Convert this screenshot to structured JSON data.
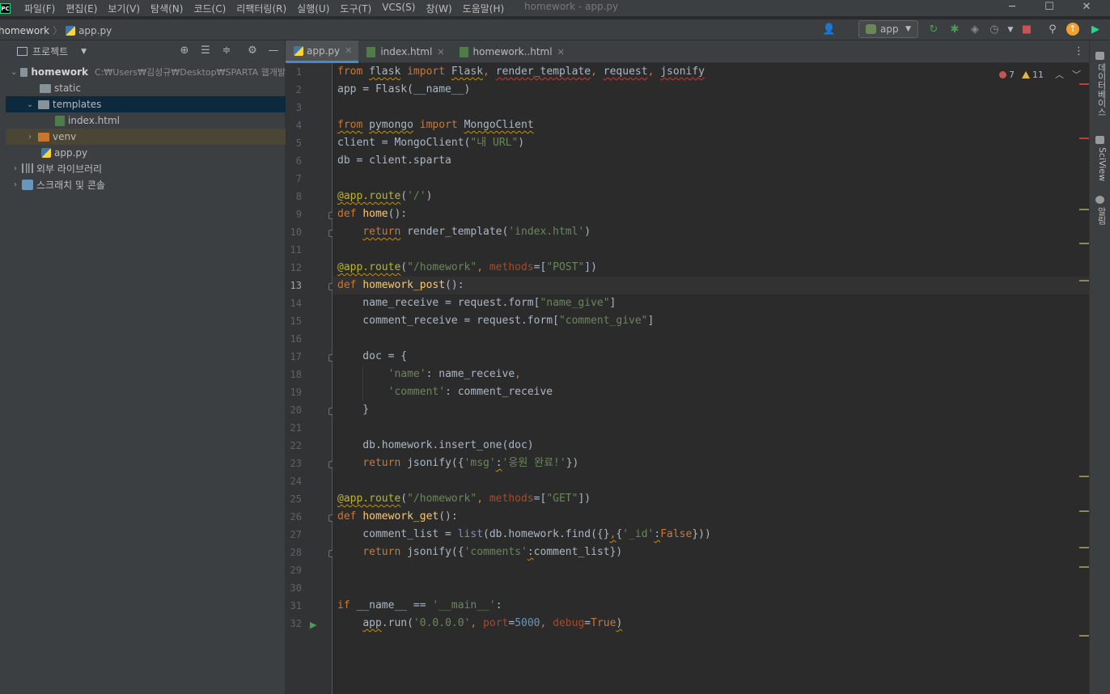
{
  "app_logo": "PC",
  "window": {
    "title": "homework - app.py",
    "menu": [
      "파일(F)",
      "편집(E)",
      "보기(V)",
      "탐색(N)",
      "코드(C)",
      "리팩터링(R)",
      "실행(U)",
      "도구(T)",
      "VCS(S)",
      "창(W)",
      "도움말(H)"
    ],
    "controls": {
      "minimize": "─",
      "maximize": "☐",
      "close": "✕"
    }
  },
  "navbar": {
    "project": "homework",
    "file": "app.py",
    "run_config": "app"
  },
  "project_panel": {
    "title": "프로젝트",
    "tree": [
      {
        "label": "homework",
        "path": "C:₩Users₩김성규₩Desktop₩SPARTA 웹개발",
        "level": 0,
        "arrow": "v",
        "icon": "folder"
      },
      {
        "label": "static",
        "level": 1,
        "arrow": "",
        "icon": "folder"
      },
      {
        "label": "templates",
        "level": 1,
        "arrow": "v",
        "icon": "folder"
      },
      {
        "label": "index.html",
        "level": 2,
        "arrow": "",
        "icon": "html"
      },
      {
        "label": "venv",
        "level": 1,
        "arrow": ">",
        "icon": "folder-orange"
      },
      {
        "label": "app.py",
        "level": 1,
        "arrow": "",
        "icon": "python"
      },
      {
        "label": "외부 라이브러리",
        "level": 0,
        "arrow": ">",
        "icon": "library"
      },
      {
        "label": "스크래치 및 콘솔",
        "level": 0,
        "arrow": ">",
        "icon": "scratch"
      }
    ]
  },
  "tabs": [
    {
      "label": "app.py",
      "active": true,
      "icon": "python"
    },
    {
      "label": "index.html",
      "active": false,
      "icon": "html"
    },
    {
      "label": "homework..html",
      "active": false,
      "icon": "html"
    }
  ],
  "inspections": {
    "errors": "7",
    "warnings": "11"
  },
  "line_numbers": [
    "1",
    "2",
    "3",
    "4",
    "5",
    "6",
    "7",
    "8",
    "9",
    "10",
    "11",
    "12",
    "13",
    "14",
    "15",
    "16",
    "17",
    "18",
    "19",
    "20",
    "21",
    "22",
    "23",
    "24",
    "25",
    "26",
    "27",
    "28",
    "29",
    "30",
    "31",
    "32"
  ],
  "current_line": 13,
  "code": {
    "l1": [
      "from",
      " ",
      "flask",
      " ",
      "import",
      " ",
      "Flask",
      ", ",
      "render_template",
      ", ",
      "request",
      ", ",
      "jsonify"
    ],
    "l2": "app = Flask(__name__)",
    "l4": [
      "from",
      " ",
      "pymongo",
      " ",
      "import",
      " ",
      "MongoClient"
    ],
    "l5": [
      "client = MongoClient(",
      "\"내 URL\"",
      ")"
    ],
    "l6": "db = client.sparta",
    "l8": [
      "@app.route",
      "(",
      "'/'",
      ")"
    ],
    "l9": [
      "def",
      " ",
      "home",
      "():"
    ],
    "l10": [
      "    ",
      "return",
      " render_template(",
      "'index.html'",
      ")"
    ],
    "l12": [
      "@app.route",
      "(",
      "\"/homework\"",
      ", ",
      "methods",
      "=[",
      "\"POST\"",
      "])"
    ],
    "l13": [
      "def",
      " ",
      "homework_post",
      "():"
    ],
    "l14": [
      "    name_receive = request.form[",
      "\"name_give\"",
      "]"
    ],
    "l15": [
      "    comment_receive = request.form[",
      "\"comment_give\"",
      "]"
    ],
    "l17": "    doc = {",
    "l18": [
      "        ",
      "'name'",
      ": name_receive",
      ","
    ],
    "l19": [
      "        ",
      "'comment'",
      ": comment_receive"
    ],
    "l20": "    }",
    "l22": "    db.homework.insert_one(doc)",
    "l23": [
      "    ",
      "return",
      " jsonify({",
      "'msg'",
      ":",
      "'응원 완료!'",
      "})"
    ],
    "l25": [
      "@app.route",
      "(",
      "\"/homework\"",
      ", ",
      "methods",
      "=[",
      "\"GET\"",
      "])"
    ],
    "l26": [
      "def",
      " ",
      "homework_get",
      "():"
    ],
    "l27": [
      "    comment_list = ",
      "list",
      "(db.homework.find({}",
      ",",
      "{",
      "'_id'",
      ":",
      "False",
      "}))"
    ],
    "l28": [
      "    ",
      "return",
      " jsonify({",
      "'comments'",
      ":",
      "comment_list})"
    ],
    "l31": [
      "if",
      " __name__ == ",
      "'__main__'",
      ":"
    ],
    "l32": [
      "    ",
      "app",
      ".run(",
      "'0.0.0.0'",
      ", ",
      "port",
      "=",
      "5000",
      ", ",
      "debug",
      "=",
      "True",
      ")"
    ]
  },
  "right_strip": [
    "데이터베이스",
    "SciView",
    "알림"
  ],
  "colors": {
    "keyword": "#cc7832",
    "string": "#6a8759",
    "decorator": "#bbb529",
    "function": "#ffc66d",
    "number": "#6897bb"
  }
}
